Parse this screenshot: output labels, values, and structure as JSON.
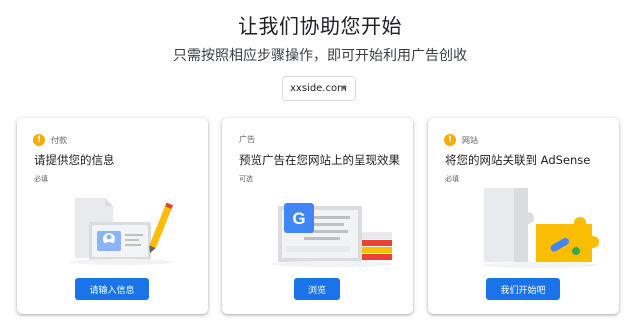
{
  "header": {
    "title": "让我们协助您开始",
    "subtitle": "只需按照相应步骤操作，即可开始利用广告创收"
  },
  "site_selector": {
    "value": "xxside.com"
  },
  "cards": [
    {
      "tag": "付款",
      "heading": "请提供您的信息",
      "note": "必填",
      "button": "请输入信息",
      "icon": "warning-icon"
    },
    {
      "tag": "广告",
      "heading": "预览广告在您网站上的呈现效果",
      "note": "可选",
      "button": "浏览",
      "icon": "none"
    },
    {
      "tag": "网站",
      "heading": "将您的网站关联到 AdSense",
      "note": "必填",
      "button": "我们开始吧",
      "icon": "warning-icon"
    }
  ],
  "colors": {
    "primary": "#1a73e8",
    "warning": "#f9ab00",
    "google_blue": "#4285f4",
    "adsense_yellow": "#fbbc04"
  }
}
